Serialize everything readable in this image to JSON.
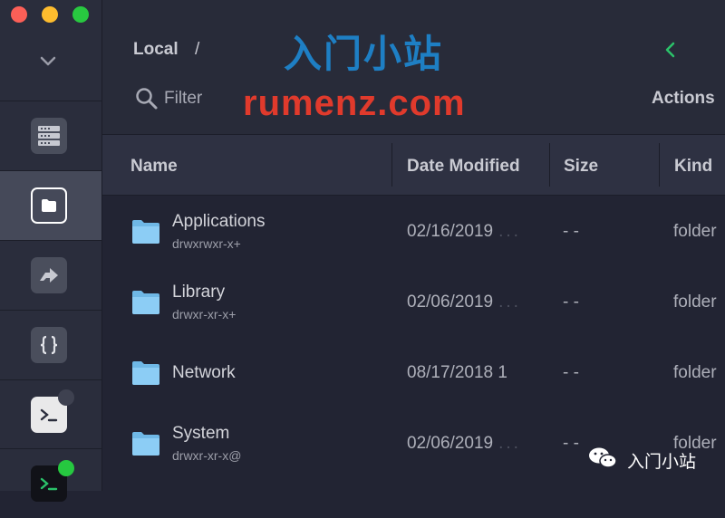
{
  "window": {
    "controls": [
      "close",
      "minimize",
      "maximize"
    ]
  },
  "sidebar": {
    "items": [
      {
        "id": "hosts",
        "icon": "server-icon",
        "active": false
      },
      {
        "id": "sftp",
        "icon": "folder-icon",
        "active": true
      },
      {
        "id": "port-forwarding",
        "icon": "forward-arrow-icon",
        "active": false
      },
      {
        "id": "snippets",
        "icon": "braces-icon",
        "active": false
      },
      {
        "id": "terminal",
        "icon": "terminal-icon",
        "active": false,
        "badge": "dark"
      },
      {
        "id": "terminal-active",
        "icon": "terminal-icon",
        "active": false,
        "badge": "green"
      }
    ]
  },
  "header": {
    "breadcrumb": {
      "root": "Local",
      "separator": "/"
    },
    "filter_label": "Filter",
    "actions_label": "Actions"
  },
  "watermark": {
    "title": "入门小站",
    "url": "rumenz.com",
    "footer": "入门小站"
  },
  "table": {
    "columns": [
      "Name",
      "Date Modified",
      "Size",
      "Kind"
    ],
    "rows": [
      {
        "name": "Applications",
        "perm": "drwxrwxr-x+",
        "date": "02/16/2019",
        "size": "- -",
        "kind": "folder"
      },
      {
        "name": "Library",
        "perm": "drwxr-xr-x+",
        "date": "02/06/2019",
        "size": "- -",
        "kind": "folder"
      },
      {
        "name": "Network",
        "perm": "",
        "date": "08/17/2018 1",
        "size": "- -",
        "kind": "folder"
      },
      {
        "name": "System",
        "perm": "drwxr-xr-x@",
        "date": "02/06/2019",
        "size": "- -",
        "kind": "folder"
      }
    ]
  },
  "colors": {
    "background": "#222433",
    "sidebar": "#2a2d3c",
    "sidebar_active": "#454959",
    "folder": "#7cc4f2",
    "accent_green": "#2bc26a",
    "watermark_blue": "#1e7fc4",
    "watermark_red": "#e03a2c"
  }
}
